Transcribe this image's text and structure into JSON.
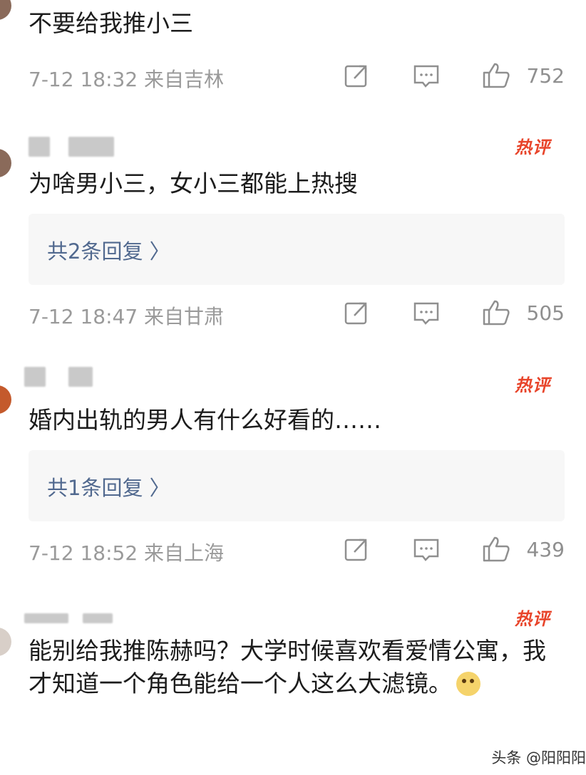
{
  "comments": [
    {
      "text": "不要给我推小三",
      "time": "7-12 18:32",
      "location": "来自吉林",
      "likes": "752"
    },
    {
      "hot_label": "热评",
      "text": "为啥男小三，女小三都能上热搜",
      "reply_label": "共2条回复 〉",
      "time": "7-12 18:47",
      "location": "来自甘肃",
      "likes": "505"
    },
    {
      "hot_label": "热评",
      "text": "婚内出轨的男人有什么好看的……",
      "reply_label": "共1条回复 〉",
      "time": "7-12 18:52",
      "location": "来自上海",
      "likes": "439"
    },
    {
      "hot_label": "热评",
      "text": "能别给我推陈赫吗？大学时候喜欢看爱情公寓，我才知道一个角色能给一个人这么大滤镜。"
    }
  ],
  "watermark": "头条 @阳阳阳",
  "icons": {
    "share": "share-icon",
    "comment": "comment-icon",
    "like": "thumbs-up-icon"
  },
  "colors": {
    "hot": "#e8442a",
    "reply_link": "#51698f",
    "meta": "#9a9a9a"
  }
}
